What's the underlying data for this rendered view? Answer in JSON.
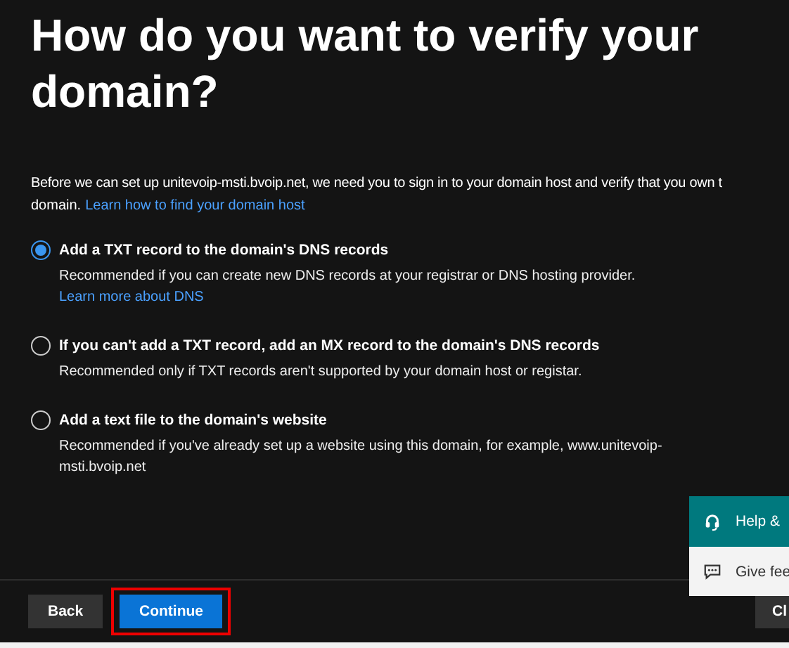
{
  "title": "How do you want to verify your domain?",
  "intro": {
    "line_1": "Before we can set up unitevoip-msti.bvoip.net, we need you to sign in to your domain host and verify that you own t",
    "line_2": "domain.",
    "link": "Learn how to find your domain host"
  },
  "options": [
    {
      "label": "Add a TXT record to the domain's DNS records",
      "description": "Recommended if you can create new DNS records at your registrar or DNS hosting provider.",
      "link": "Learn more about DNS",
      "selected": true
    },
    {
      "label": "If you can't add a TXT record, add an MX record to the domain's DNS records",
      "description": "Recommended only if TXT records aren't supported by your domain host or registar.",
      "selected": false
    },
    {
      "label": "Add a text file to the domain's website",
      "description": "Recommended if you've already set up a website using this domain, for example, www.unitevoip-msti.bvoip.net",
      "selected": false
    }
  ],
  "help_panel": [
    {
      "kind": "help",
      "label": "Help &"
    },
    {
      "kind": "feedback",
      "label": "Give fee"
    }
  ],
  "buttons": [
    {
      "label": "Back",
      "kind": "secondary",
      "highlighted": false
    },
    {
      "label": "Continue",
      "kind": "primary",
      "highlighted": true
    },
    {
      "label": "Cl",
      "kind": "edge",
      "highlighted": false
    }
  ]
}
